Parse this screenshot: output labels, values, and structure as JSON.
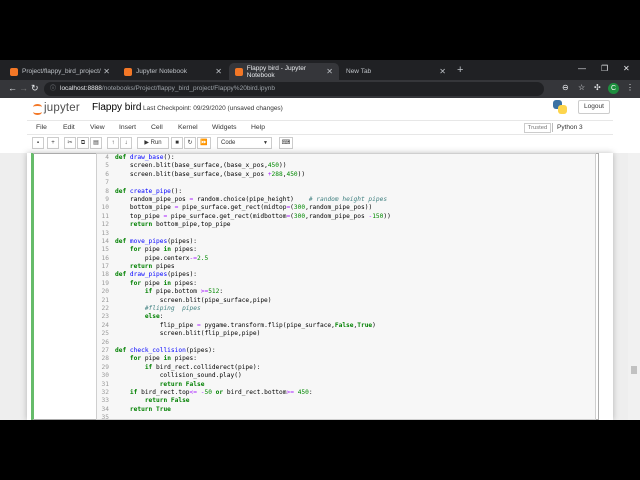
{
  "browser": {
    "tabs": [
      {
        "title": "Project/flappy_bird_project/",
        "active": false
      },
      {
        "title": "Jupyter Notebook",
        "active": false
      },
      {
        "title": "Flappy bird - Jupyter Notebook",
        "active": true
      },
      {
        "title": "New Tab",
        "active": false
      }
    ],
    "url_host": "localhost:8888",
    "url_path": "/notebooks/Project/flappy_bird_project/Flappy%20bird.ipynb",
    "profile_initial": "C"
  },
  "jupyter": {
    "logo_text": "jupyter",
    "notebook_title": "Flappy bird",
    "checkpoint": "Last Checkpoint: 09/29/2020  (unsaved changes)",
    "logout_label": "Logout",
    "menu": [
      "File",
      "Edit",
      "View",
      "Insert",
      "Cell",
      "Kernel",
      "Widgets",
      "Help"
    ],
    "trusted_label": "Trusted",
    "kernel_name": "Python 3",
    "run_label": "Run",
    "cell_type": "Code"
  },
  "code_lines": [
    {
      "n": "4",
      "t": "def draw_base():"
    },
    {
      "n": "5",
      "t": "    screen.blit(base_surface,(base_x_pos,450))"
    },
    {
      "n": "6",
      "t": "    screen.blit(base_surface,(base_x_pos +288,450))"
    },
    {
      "n": "7",
      "t": ""
    },
    {
      "n": "8",
      "t": "def create_pipe():"
    },
    {
      "n": "9",
      "t": "    random_pipe_pos = random.choice(pipe_height)    # random height pipes"
    },
    {
      "n": "10",
      "t": "    bottom_pipe = pipe_surface.get_rect(midtop=(300,random_pipe_pos))"
    },
    {
      "n": "11",
      "t": "    top_pipe = pipe_surface.get_rect(midbottom=(300,random_pipe_pos -150))"
    },
    {
      "n": "12",
      "t": "    return bottom_pipe,top_pipe"
    },
    {
      "n": "13",
      "t": ""
    },
    {
      "n": "14",
      "t": "def move_pipes(pipes):"
    },
    {
      "n": "15",
      "t": "    for pipe in pipes:"
    },
    {
      "n": "16",
      "t": "        pipe.centerx-=2.5"
    },
    {
      "n": "17",
      "t": "    return pipes"
    },
    {
      "n": "18",
      "t": "def draw_pipes(pipes):"
    },
    {
      "n": "19",
      "t": "    for pipe in pipes:"
    },
    {
      "n": "20",
      "t": "        if pipe.bottom >=512:"
    },
    {
      "n": "21",
      "t": "            screen.blit(pipe_surface,pipe)"
    },
    {
      "n": "22",
      "t": "        #fliping  pipes"
    },
    {
      "n": "23",
      "t": "        else:"
    },
    {
      "n": "24",
      "t": "            flip_pipe = pygame.transform.flip(pipe_surface,False,True)"
    },
    {
      "n": "25",
      "t": "            screen.blit(flip_pipe,pipe)"
    },
    {
      "n": "26",
      "t": ""
    },
    {
      "n": "27",
      "t": "def check_collision(pipes):"
    },
    {
      "n": "28",
      "t": "    for pipe in pipes:"
    },
    {
      "n": "29",
      "t": "        if bird_rect.colliderect(pipe):"
    },
    {
      "n": "30",
      "t": "            collision_sound.play()"
    },
    {
      "n": "31",
      "t": "            return False"
    },
    {
      "n": "32",
      "t": "    if bird_rect.top<= -50 or bird_rect.bottom>= 450:"
    },
    {
      "n": "33",
      "t": "        return False"
    },
    {
      "n": "34",
      "t": "    return True"
    },
    {
      "n": "35",
      "t": ""
    }
  ]
}
